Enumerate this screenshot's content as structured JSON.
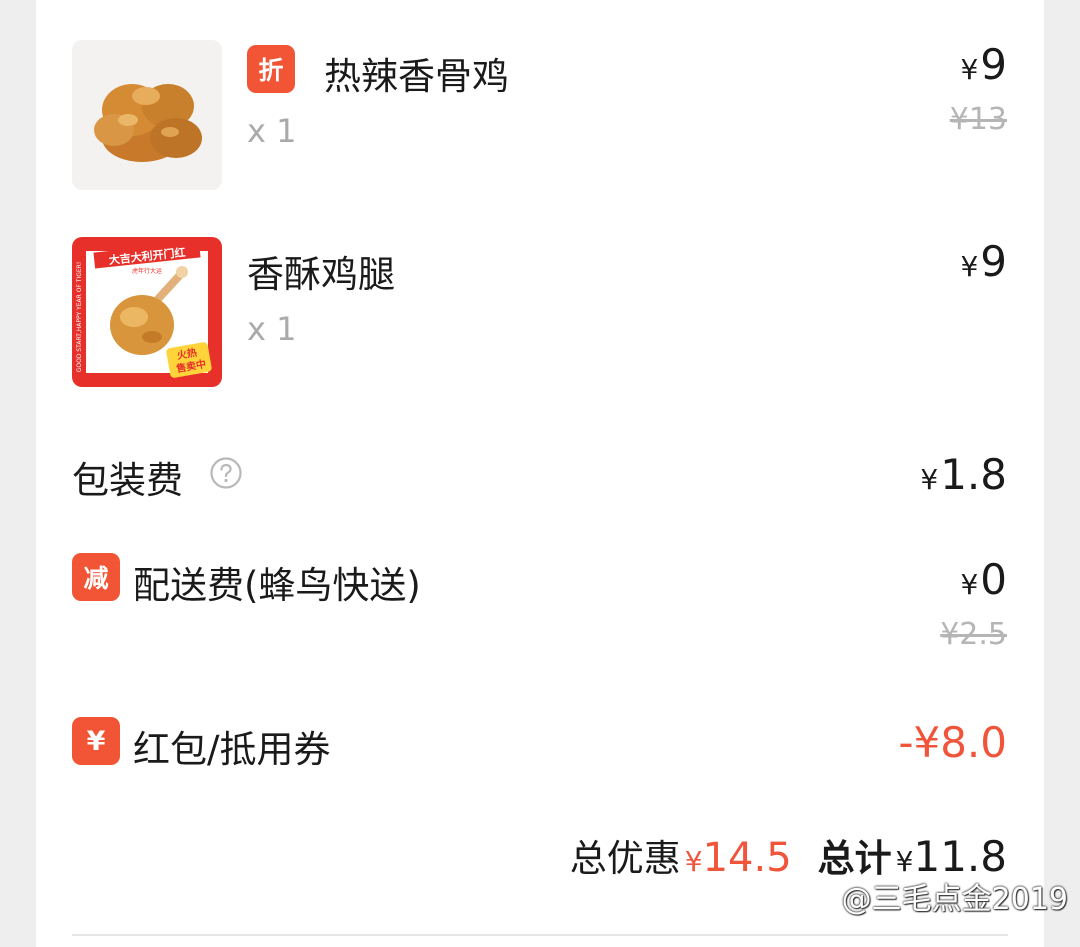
{
  "items": [
    {
      "badge": "折",
      "name": "热辣香骨鸡",
      "qty": "x 1",
      "currency": "¥",
      "price": "9",
      "original_price": "¥13",
      "image_icon": "fried-chicken-pieces"
    },
    {
      "name": "香酥鸡腿",
      "qty": "x 1",
      "currency": "¥",
      "price": "9",
      "image_icon": "drumstick-promo",
      "image_title": "大吉大利开门红",
      "image_subtitle": "虎年行大运",
      "image_sticker_1": "火热",
      "image_sticker_2": "售卖中",
      "image_border_text": "GOOD START,HAPPY YEAR OF TIGER!"
    }
  ],
  "packaging": {
    "label": "包装费",
    "help_icon": "question-circle",
    "currency": "¥",
    "amount": "1.8"
  },
  "delivery": {
    "badge": "减",
    "label": "配送费(蜂鸟快送)",
    "currency": "¥",
    "amount": "0",
    "original": "¥2.5"
  },
  "coupon": {
    "badge": "¥",
    "label": "红包/抵用券",
    "amount": "-¥8.0"
  },
  "summary": {
    "discount_label": "总优惠",
    "discount_currency": "¥",
    "discount_amount": "14.5",
    "total_label": "总计",
    "total_currency": "¥",
    "total_amount": "11.8"
  },
  "watermark": "@三毛点金2019",
  "colors": {
    "accent": "#f25536",
    "red_text": "#f0553c",
    "strike": "#b5b5b5",
    "qty": "#aaaaaa"
  }
}
